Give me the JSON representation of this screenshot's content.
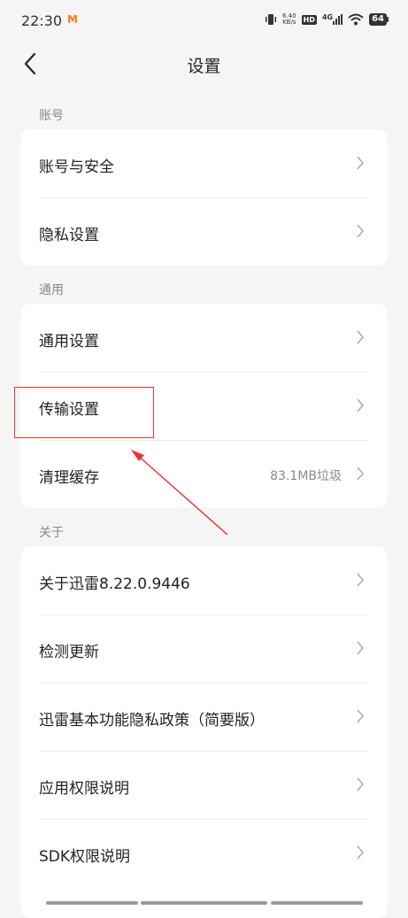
{
  "status_bar": {
    "time": "22:30",
    "notification_glyph": "M",
    "net_speed_value": "6.40",
    "net_speed_unit": "KB/s",
    "hd_badge": "HD",
    "network_type": "4G",
    "battery_level": "64"
  },
  "header": {
    "title": "设置",
    "back_icon": "chevron-left-icon"
  },
  "sections": [
    {
      "label": "账号",
      "items": [
        {
          "label": "账号与安全",
          "value": ""
        },
        {
          "label": "隐私设置",
          "value": ""
        }
      ]
    },
    {
      "label": "通用",
      "items": [
        {
          "label": "通用设置",
          "value": ""
        },
        {
          "label": "传输设置",
          "value": ""
        },
        {
          "label": "清理缓存",
          "value": "83.1MB垃圾"
        }
      ]
    },
    {
      "label": "关于",
      "items": [
        {
          "label": "关于迅雷8.22.0.9446",
          "value": ""
        },
        {
          "label": "检测更新",
          "value": ""
        },
        {
          "label": "迅雷基本功能隐私政策（简要版）",
          "value": ""
        },
        {
          "label": "应用权限说明",
          "value": ""
        },
        {
          "label": "SDK权限说明",
          "value": ""
        }
      ]
    }
  ],
  "annotation": {
    "color": "#e53935",
    "highlighted_item": "传输设置"
  }
}
